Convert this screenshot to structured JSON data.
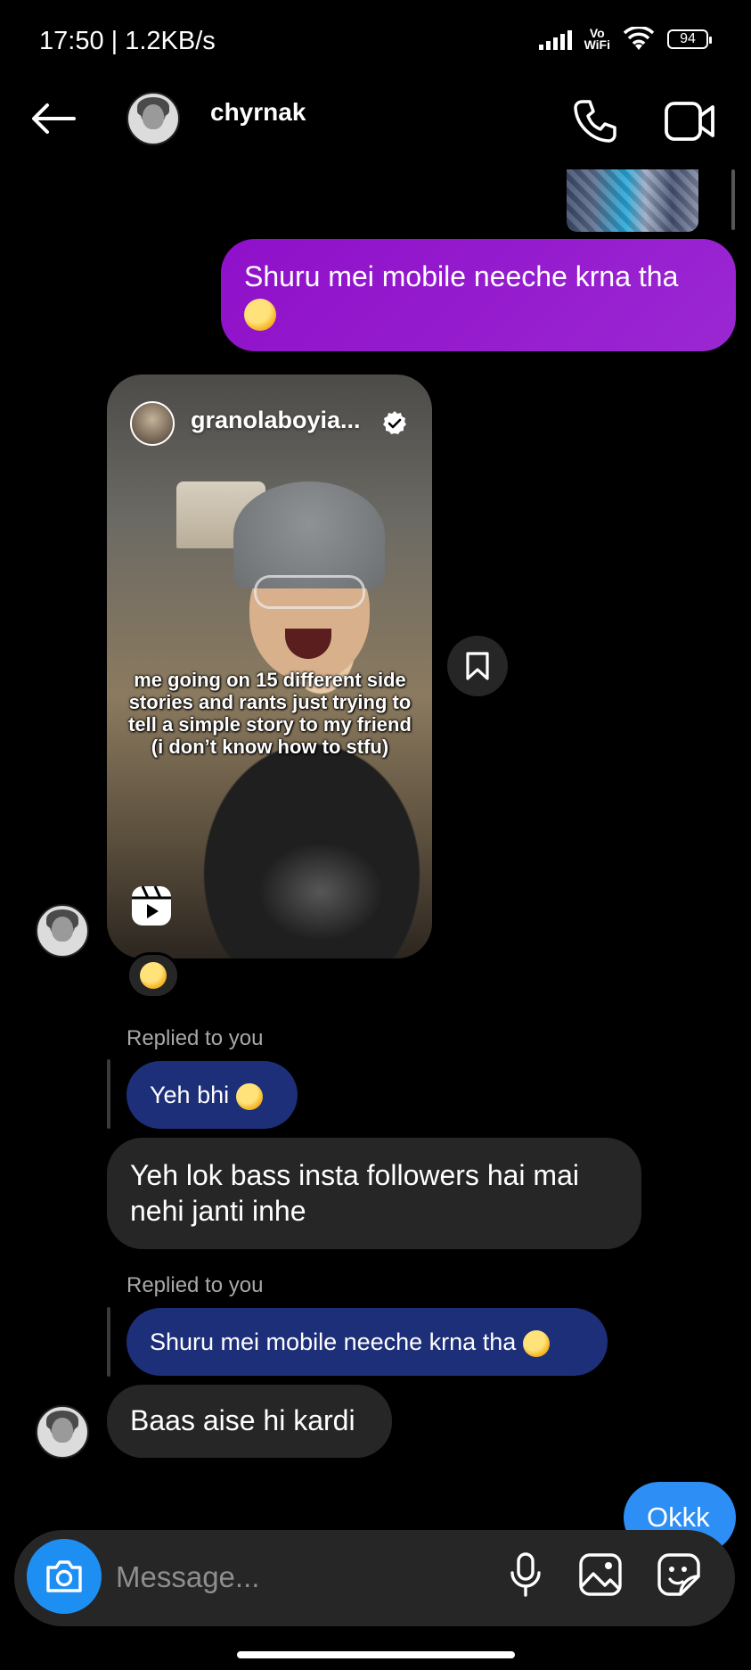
{
  "status_bar": {
    "time_speed": "17:50 | 1.2KB/s",
    "vowifi_top": "Vo",
    "vowifi_bottom": "WiFi",
    "battery": "94"
  },
  "header": {
    "username": "chyrnak"
  },
  "messages": {
    "sent_1": "Shuru mei mobile neeche krna tha",
    "reel": {
      "username": "granolaboyia...",
      "caption": "me going on 15 different side stories and rants just trying to tell a simple story to my friend (i don’t know how to stfu)",
      "reaction_icon": "tears-of-joy-emoji-icon"
    },
    "reply_1": {
      "label": "Replied to you",
      "quoted": "Yeh bhi",
      "text": "Yeh lok bass insta followers hai mai nehi janti inhe"
    },
    "reply_2": {
      "label": "Replied to you",
      "quoted": "Shuru mei mobile neeche krna tha",
      "text": "Baas aise hi kardi"
    },
    "sent_2": "Okkk"
  },
  "composer": {
    "placeholder": "Message..."
  },
  "colors": {
    "sent_bubble": "#9b27d3",
    "received_bubble": "#262626",
    "quoted_bubble": "#1e2f7a",
    "camera_button": "#1d8ff3",
    "okk_bubble": "#2d8ff6"
  }
}
